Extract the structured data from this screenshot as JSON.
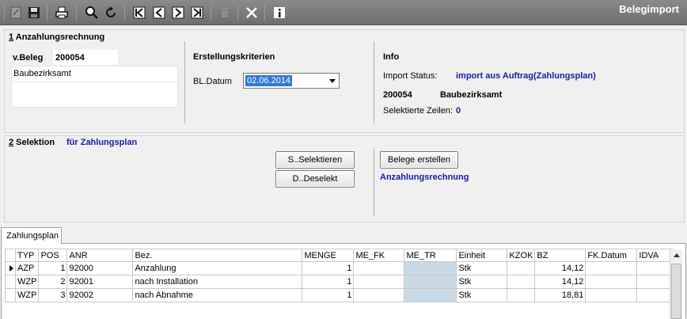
{
  "window": {
    "title": "Belegimport"
  },
  "toolbar": {
    "icons": [
      "new-doc-icon",
      "save-icon",
      "print-icon",
      "search-icon",
      "refresh-icon",
      "first-icon",
      "prev-icon",
      "next-icon",
      "last-icon",
      "delete-icon",
      "close-icon",
      "info-icon"
    ]
  },
  "section1": {
    "num": "1",
    "title": " Anzahlungsrechnung",
    "beleg_label": "v.Beleg",
    "beleg_value": "200054",
    "address_line": "Baubezirksamt",
    "criteria_title": "Erstellungskriterien",
    "date_label": "BL.Datum",
    "date_value": "02.06.2014",
    "info_title": "Info",
    "import_status_label": "Import Status:",
    "import_status_value": "import aus Auftrag(Zahlungsplan)",
    "info_beleg": "200054",
    "info_name": "Baubezirksamt",
    "selected_rows_label": "Selektierte Zeilen:",
    "selected_rows_value": "0"
  },
  "section2": {
    "num": "2",
    "title": " Selektion",
    "subtitle": "für Zahlungsplan",
    "select_button": "S..Selektieren",
    "deselect_button": "D..Deselekt",
    "create_button": "Belege erstellen",
    "create_type": "Anzahlungsrechnung"
  },
  "tab": {
    "label": "Zahlungsplan"
  },
  "grid": {
    "columns": [
      "TYP",
      "POS",
      "ANR",
      "Bez.",
      "MENGE",
      "ME_FK",
      "ME_TR",
      "Einheit",
      "KZOK",
      "BZ",
      "FK.Datum",
      "IDVA"
    ],
    "rows": [
      [
        "AZP",
        "1",
        "92000",
        "Anzahlung",
        "1",
        "",
        "",
        "Stk",
        "",
        "14,12",
        "",
        ""
      ],
      [
        "WZP",
        "2",
        "92001",
        "nach Installation",
        "1",
        "",
        "",
        "Stk",
        "",
        "14,12",
        "",
        ""
      ],
      [
        "WZP",
        "3",
        "92002",
        "nach Abnahme",
        "1",
        "",
        "",
        "Stk",
        "",
        "18,81",
        "",
        ""
      ]
    ]
  }
}
